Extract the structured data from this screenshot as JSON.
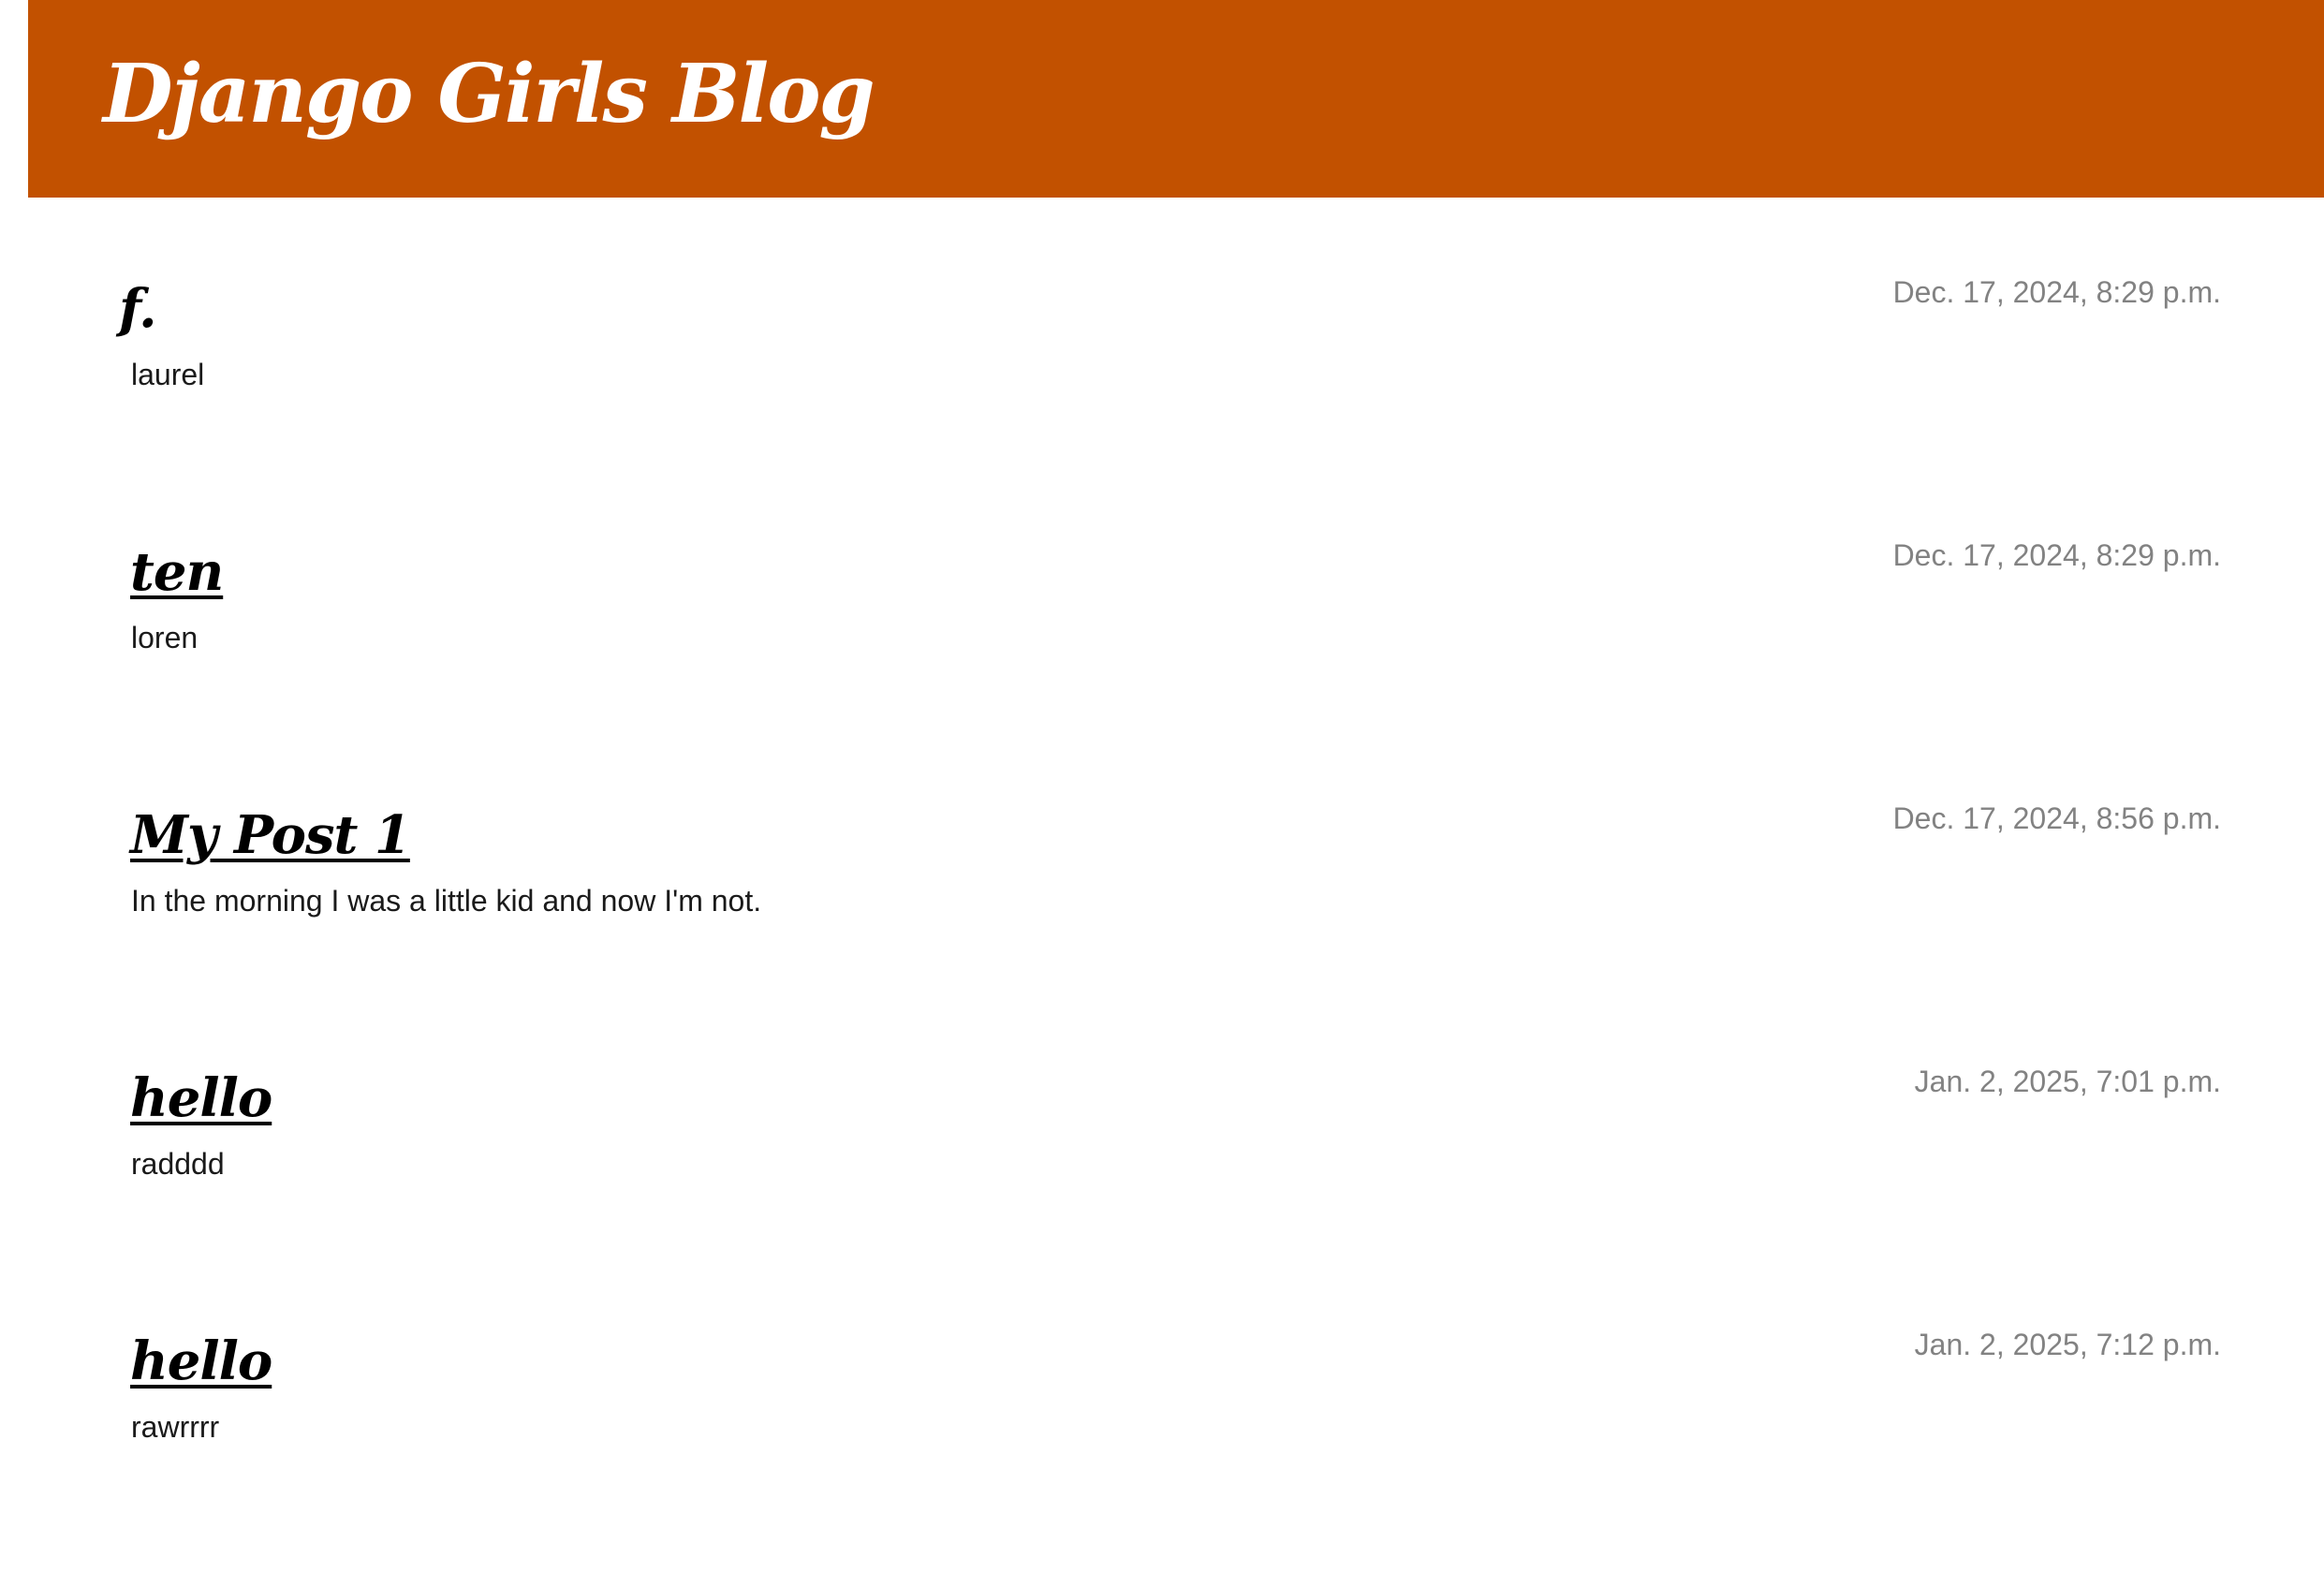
{
  "header": {
    "site_title": "Django Girls Blog",
    "background_color": "#c25100"
  },
  "posts": [
    {
      "title": "f.",
      "date": "Dec. 17, 2024, 8:29 p.m.",
      "text": "laurel"
    },
    {
      "title": "ten",
      "date": "Dec. 17, 2024, 8:29 p.m.",
      "text": "loren"
    },
    {
      "title": "My Post 1",
      "date": "Dec. 17, 2024, 8:56 p.m.",
      "text": "In the morning I was a little kid and now I'm not."
    },
    {
      "title": "hello",
      "date": "Jan. 2, 2025, 7:01 p.m.",
      "text": "radddd"
    },
    {
      "title": "hello",
      "date": "Jan. 2, 2025, 7:12 p.m.",
      "text": "rawrrrr"
    }
  ]
}
